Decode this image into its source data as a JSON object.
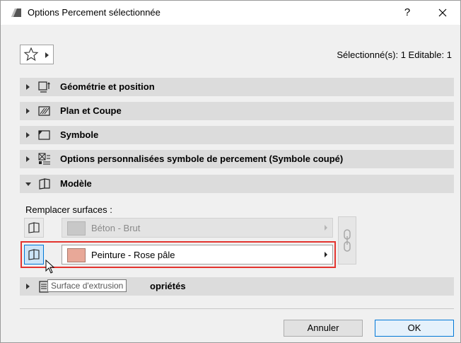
{
  "window": {
    "title": "Options Percement sélectionnée",
    "help_label": "?"
  },
  "header": {
    "selection_info": "Sélectionné(s): 1 Editable: 1"
  },
  "panels": [
    {
      "label": "Géométrie et position",
      "icon": "geometry-icon",
      "expanded": false
    },
    {
      "label": "Plan et Coupe",
      "icon": "plan-section-icon",
      "expanded": false
    },
    {
      "label": "Symbole",
      "icon": "symbol-icon",
      "expanded": false
    },
    {
      "label": "Options personnalisées symbole de percement (Symbole coupé)",
      "icon": "custom-symbol-icon",
      "expanded": false
    },
    {
      "label": "Modèle",
      "icon": "model-icon",
      "expanded": true
    }
  ],
  "model": {
    "replace_label": "Remplacer surfaces :",
    "surfaces": [
      {
        "label": "Béton - Brut",
        "swatch_color": "#c8c8c8",
        "enabled": false
      },
      {
        "label": "Peinture - Rose pâle",
        "swatch_color": "#e8a898",
        "enabled": true
      }
    ]
  },
  "tooltip": "Surface d'extrusion",
  "obscured_panel": {
    "label_visible_part": "opriétés"
  },
  "buttons": {
    "cancel": "Annuler",
    "ok": "OK"
  },
  "colors": {
    "highlight": "#e3342f",
    "accent": "#0078d7"
  }
}
